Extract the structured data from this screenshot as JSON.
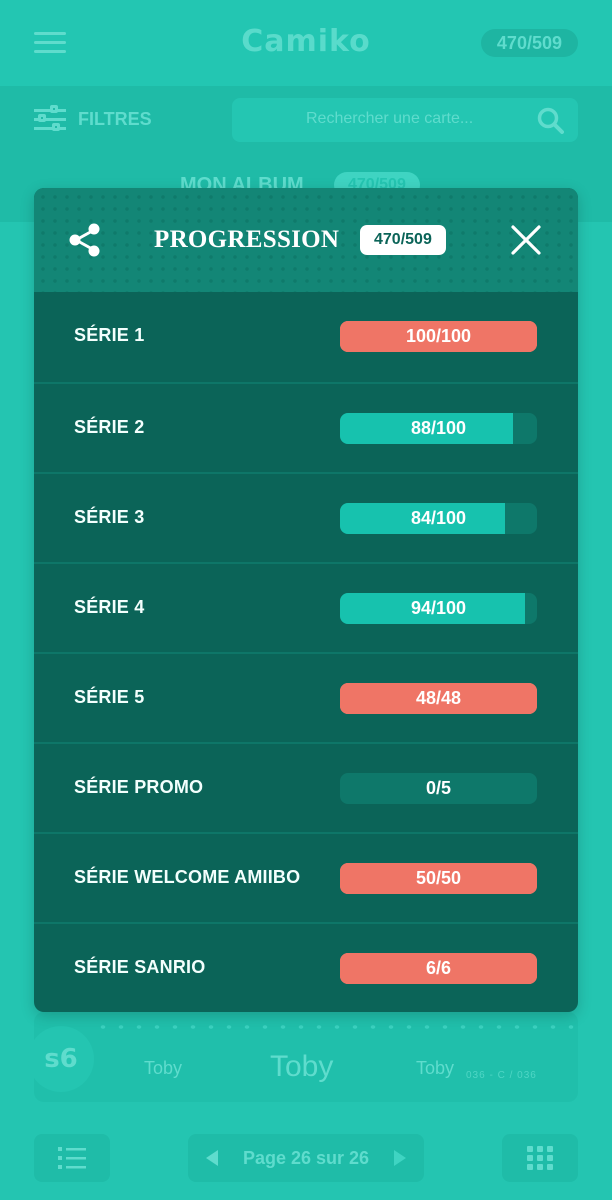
{
  "app": {
    "logo": "Camiko",
    "counter": "470/509"
  },
  "filters": {
    "label": "FILTRES",
    "search_placeholder": "Rechercher une carte..."
  },
  "album": {
    "title": "MON ALBUM",
    "count": "470/509"
  },
  "card": {
    "series_badge": "s6",
    "name_left": "Toby",
    "name_center": "Toby",
    "name_right": "Toby",
    "code": "036 - C / 036"
  },
  "pager": {
    "text": "Page 26 sur 26"
  },
  "modal": {
    "title": "PROGRESSION",
    "total": "470/509",
    "rows": [
      {
        "label": "SÉRIE 1",
        "value": "100/100",
        "fraction": 1.0
      },
      {
        "label": "SÉRIE 2",
        "value": "88/100",
        "fraction": 0.88
      },
      {
        "label": "SÉRIE 3",
        "value": "84/100",
        "fraction": 0.84
      },
      {
        "label": "SÉRIE 4",
        "value": "94/100",
        "fraction": 0.94
      },
      {
        "label": "SÉRIE 5",
        "value": "48/48",
        "fraction": 1.0
      },
      {
        "label": "SÉRIE PROMO",
        "value": "0/5",
        "fraction": 0.0
      },
      {
        "label": "SÉRIE WELCOME AMIIBO",
        "value": "50/50",
        "fraction": 1.0
      },
      {
        "label": "SÉRIE SANRIO",
        "value": "6/6",
        "fraction": 1.0
      }
    ]
  },
  "colors": {
    "complete": "#ef7566",
    "progress": "#17c2ae",
    "track": "#0e786a",
    "modal_bg": "#0b6458"
  },
  "icons": {
    "menu": "hamburger-icon",
    "filter": "sliders-icon",
    "search": "search-icon",
    "share": "share-icon",
    "close": "close-icon",
    "list": "list-icon",
    "grid": "grid-icon"
  }
}
